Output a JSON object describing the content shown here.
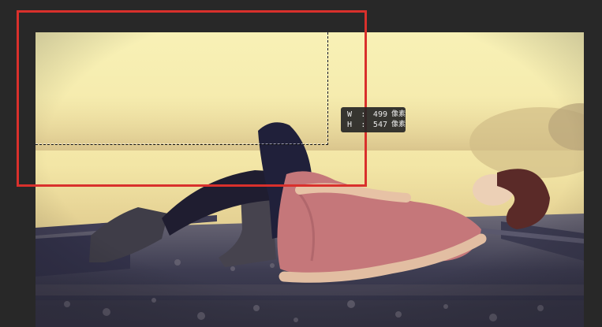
{
  "canvas": {
    "background_color": "#282828",
    "image_subject": "photo"
  },
  "highlight": {
    "color": "#d9302c"
  },
  "size_tooltip": {
    "width_label": "W",
    "height_label": "H",
    "colon": ":",
    "width_value": "499",
    "height_value": "547",
    "unit": "像素"
  }
}
